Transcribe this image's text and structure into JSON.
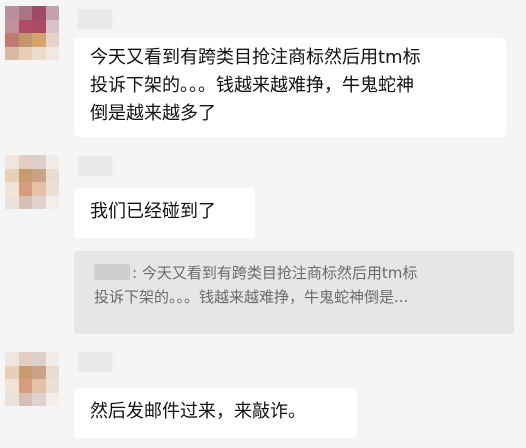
{
  "chat": {
    "messages": [
      {
        "type": "text",
        "lines": [
          "今天又看到有跨类目抢注商标然后用tm标",
          "投诉下架的。。。钱越来越难挣，牛鬼蛇神",
          "倒是越来越多了"
        ]
      },
      {
        "type": "text",
        "lines": [
          "我们已经碰到了"
        ]
      },
      {
        "type": "quote",
        "author_separator": ": ",
        "lines": [
          "今天又看到有跨类目抢注商标然后用tm标",
          "投诉下架的。。。钱越来越难挣，牛鬼蛇神倒是..."
        ]
      },
      {
        "type": "text",
        "lines": [
          "然后发邮件过来，来敲诈。"
        ]
      }
    ]
  }
}
